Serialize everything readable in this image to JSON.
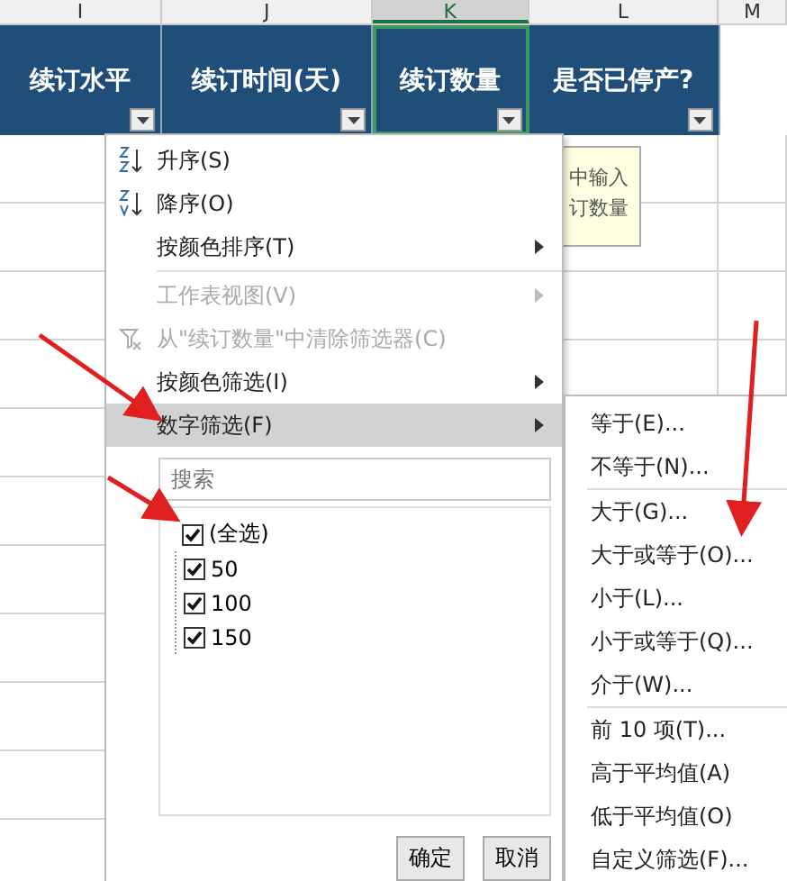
{
  "columns": [
    {
      "letter": "I",
      "header": "续订水平",
      "selected": false
    },
    {
      "letter": "J",
      "header": "续订时间(天)",
      "selected": false
    },
    {
      "letter": "K",
      "header": "续订数量",
      "selected": true
    },
    {
      "letter": "L",
      "header": "是否已停产?",
      "selected": false
    },
    {
      "letter": "M",
      "selected": false
    }
  ],
  "tooltip": {
    "lines": [
      "中输入",
      "订数量"
    ]
  },
  "menu": {
    "items": [
      {
        "kind": "sort_asc",
        "label": "升序(S)",
        "disabled": false,
        "submenu": false,
        "selected": false
      },
      {
        "kind": "sort_desc",
        "label": "降序(O)",
        "disabled": false,
        "submenu": false,
        "selected": false
      },
      {
        "kind": "item",
        "label": "按颜色排序(T)",
        "disabled": false,
        "submenu": true,
        "selected": false
      },
      {
        "kind": "separator"
      },
      {
        "kind": "item",
        "label": "工作表视图(V)",
        "disabled": true,
        "submenu": true,
        "selected": false
      },
      {
        "kind": "clear",
        "label": "从\"续订数量\"中清除筛选器(C)",
        "disabled": true,
        "submenu": false,
        "selected": false
      },
      {
        "kind": "item",
        "label": "按颜色筛选(I)",
        "disabled": false,
        "submenu": true,
        "selected": false
      },
      {
        "kind": "item",
        "label": "数字筛选(F)",
        "disabled": false,
        "submenu": true,
        "selected": true
      }
    ],
    "search": {
      "placeholder": "搜索"
    },
    "tree": [
      {
        "label": "(全选)",
        "checked": true,
        "children": [
          {
            "label": "50",
            "checked": true
          },
          {
            "label": "100",
            "checked": true
          },
          {
            "label": "150",
            "checked": true
          }
        ]
      }
    ],
    "buttons": [
      "确定",
      "取消"
    ]
  },
  "submenu": {
    "items": [
      {
        "kind": "item",
        "label": "等于(E)..."
      },
      {
        "kind": "item",
        "label": "不等于(N)..."
      },
      {
        "kind": "separator"
      },
      {
        "kind": "item",
        "label": "大于(G)..."
      },
      {
        "kind": "item",
        "label": "大于或等于(O)..."
      },
      {
        "kind": "item",
        "label": "小于(L)..."
      },
      {
        "kind": "item",
        "label": "小于或等于(Q)..."
      },
      {
        "kind": "item",
        "label": "介于(W)..."
      },
      {
        "kind": "separator"
      },
      {
        "kind": "item",
        "label": "前 10 项(T)..."
      },
      {
        "kind": "item",
        "label": "高于平均值(A)"
      },
      {
        "kind": "item",
        "label": "低于平均值(O)"
      },
      {
        "kind": "item",
        "label": "自定义筛选(F)..."
      }
    ]
  }
}
